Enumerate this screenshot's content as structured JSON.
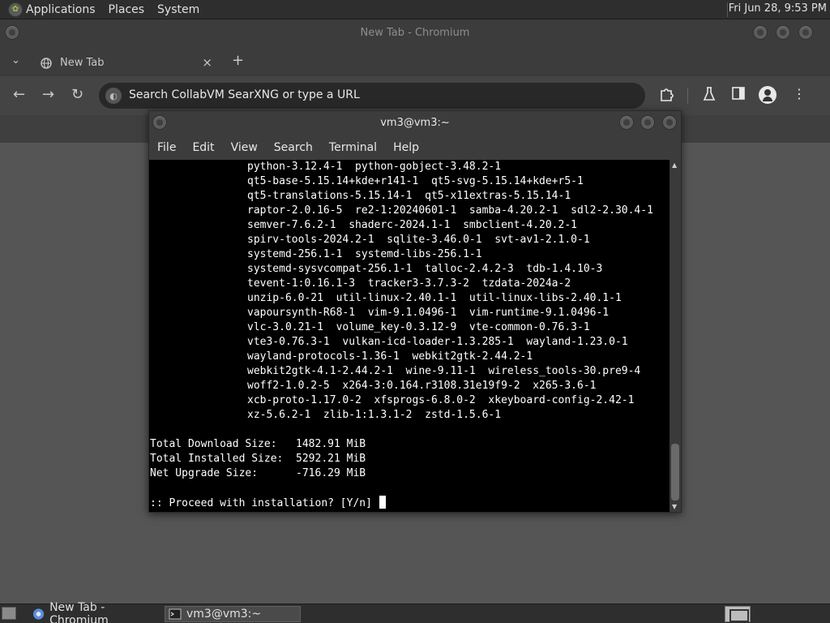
{
  "top_panel": {
    "menus": [
      "Applications",
      "Places",
      "System"
    ],
    "clock": "Fri Jun 28,  9:53 PM"
  },
  "chromium": {
    "window_title": "New Tab - Chromium",
    "tab_title": "New Tab",
    "tab_close": "×",
    "new_tab": "+",
    "omnibox_placeholder": "Search CollabVM SearXNG or type a URL",
    "nav": {
      "back": "←",
      "forward": "→",
      "reload": "↻"
    }
  },
  "terminal": {
    "window_title": "vm3@vm3:~",
    "menus": [
      "File",
      "Edit",
      "View",
      "Search",
      "Terminal",
      "Help"
    ],
    "package_lines": [
      "python-3.12.4-1  python-gobject-3.48.2-1",
      "qt5-base-5.15.14+kde+r141-1  qt5-svg-5.15.14+kde+r5-1",
      "qt5-translations-5.15.14-1  qt5-x11extras-5.15.14-1",
      "raptor-2.0.16-5  re2-1:20240601-1  samba-4.20.2-1  sdl2-2.30.4-1",
      "semver-7.6.2-1  shaderc-2024.1-1  smbclient-4.20.2-1",
      "spirv-tools-2024.2-1  sqlite-3.46.0-1  svt-av1-2.1.0-1",
      "systemd-256.1-1  systemd-libs-256.1-1",
      "systemd-sysvcompat-256.1-1  talloc-2.4.2-3  tdb-1.4.10-3",
      "tevent-1:0.16.1-3  tracker3-3.7.3-2  tzdata-2024a-2",
      "unzip-6.0-21  util-linux-2.40.1-1  util-linux-libs-2.40.1-1",
      "vapoursynth-R68-1  vim-9.1.0496-1  vim-runtime-9.1.0496-1",
      "vlc-3.0.21-1  volume_key-0.3.12-9  vte-common-0.76.3-1",
      "vte3-0.76.3-1  vulkan-icd-loader-1.3.285-1  wayland-1.23.0-1",
      "wayland-protocols-1.36-1  webkit2gtk-2.44.2-1",
      "webkit2gtk-4.1-2.44.2-1  wine-9.11-1  wireless_tools-30.pre9-4",
      "woff2-1.0.2-5  x264-3:0.164.r3108.31e19f9-2  x265-3.6-1",
      "xcb-proto-1.17.0-2  xfsprogs-6.8.0-2  xkeyboard-config-2.42-1",
      "xz-5.6.2-1  zlib-1:1.3.1-2  zstd-1.5.6-1"
    ],
    "summary_lines": [
      "Total Download Size:   1482.91 MiB",
      "Total Installed Size:  5292.21 MiB",
      "Net Upgrade Size:      -716.29 MiB"
    ],
    "prompt": ":: Proceed with installation? [Y/n] "
  },
  "taskbar": {
    "items": [
      {
        "label": "New Tab - Chromium",
        "icon": "chromium-icon"
      },
      {
        "label": "vm3@vm3:~",
        "icon": "terminal-icon"
      }
    ]
  }
}
